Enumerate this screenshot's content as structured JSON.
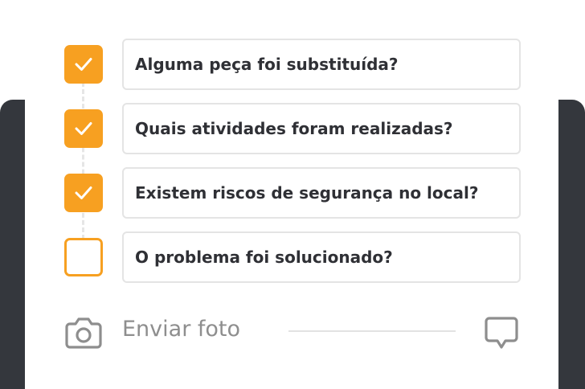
{
  "checklist": {
    "items": [
      {
        "question": "Alguma peça foi substituída?",
        "checked": true
      },
      {
        "question": "Quais atividades foram realizadas?",
        "checked": true
      },
      {
        "question": "Existem riscos de segurança no local?",
        "checked": true
      },
      {
        "question": "O problema foi solucionado?",
        "checked": false
      }
    ]
  },
  "photo": {
    "label": "Enviar foto",
    "icon": "camera-icon"
  },
  "comment": {
    "icon": "comment-icon"
  },
  "colors": {
    "accent": "#f7a021",
    "frame": "#34373d",
    "text": "#2f3035",
    "muted": "#8e8e8e",
    "border": "#e4e4e4"
  }
}
